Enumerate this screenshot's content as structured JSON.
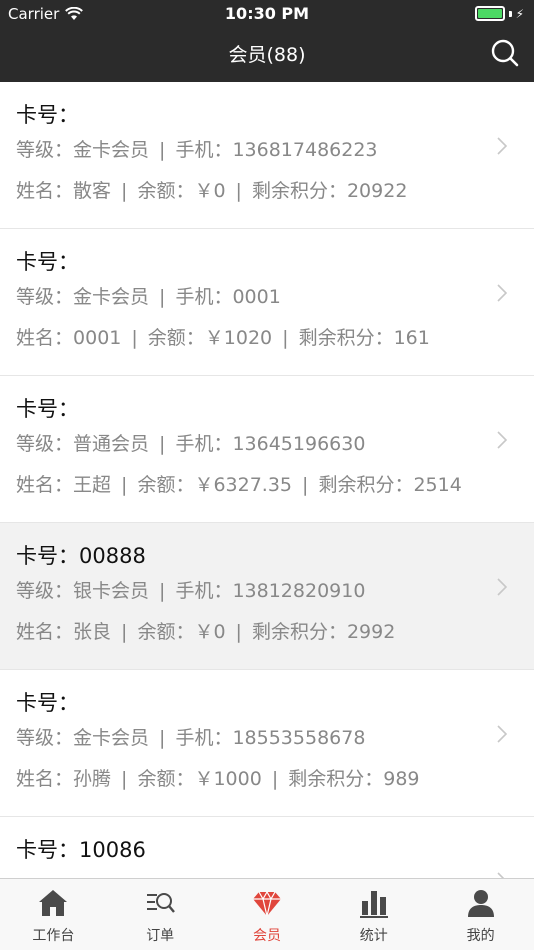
{
  "status": {
    "carrier": "Carrier",
    "time": "10:30 PM"
  },
  "nav": {
    "title": "会员(88)"
  },
  "labels": {
    "card": "卡号：",
    "level": "等级：",
    "phone": "手机：",
    "name": "姓名：",
    "balance": "余额：",
    "points": "剩余积分：",
    "sep": "|"
  },
  "members": [
    {
      "card": "",
      "level": "金卡会员",
      "phone": "136817486223",
      "name": "散客",
      "balance": "￥0",
      "points": "20922"
    },
    {
      "card": "",
      "level": "金卡会员",
      "phone": "0001",
      "name": "0001",
      "balance": "￥1020",
      "points": "161"
    },
    {
      "card": "",
      "level": "普通会员",
      "phone": "13645196630",
      "name": "王超",
      "balance": "￥6327.35",
      "points": "2514"
    },
    {
      "card": "00888",
      "level": "银卡会员",
      "phone": "13812820910",
      "name": "张良",
      "balance": "￥0",
      "points": "2992"
    },
    {
      "card": "",
      "level": "金卡会员",
      "phone": "18553558678",
      "name": "孙腾",
      "balance": "￥1000",
      "points": "989"
    },
    {
      "card": "10086",
      "level": "",
      "phone": "",
      "name": "",
      "balance": "",
      "points": ""
    }
  ],
  "tabs": [
    {
      "label": "工作台",
      "icon": "home-icon"
    },
    {
      "label": "订单",
      "icon": "order-search-icon"
    },
    {
      "label": "会员",
      "icon": "gem-icon",
      "active": true
    },
    {
      "label": "统计",
      "icon": "bar-chart-icon"
    },
    {
      "label": "我的",
      "icon": "person-icon"
    }
  ],
  "colors": {
    "topbar": "#2b2b2b",
    "accent": "#e0463c",
    "battery": "#4cd964"
  }
}
